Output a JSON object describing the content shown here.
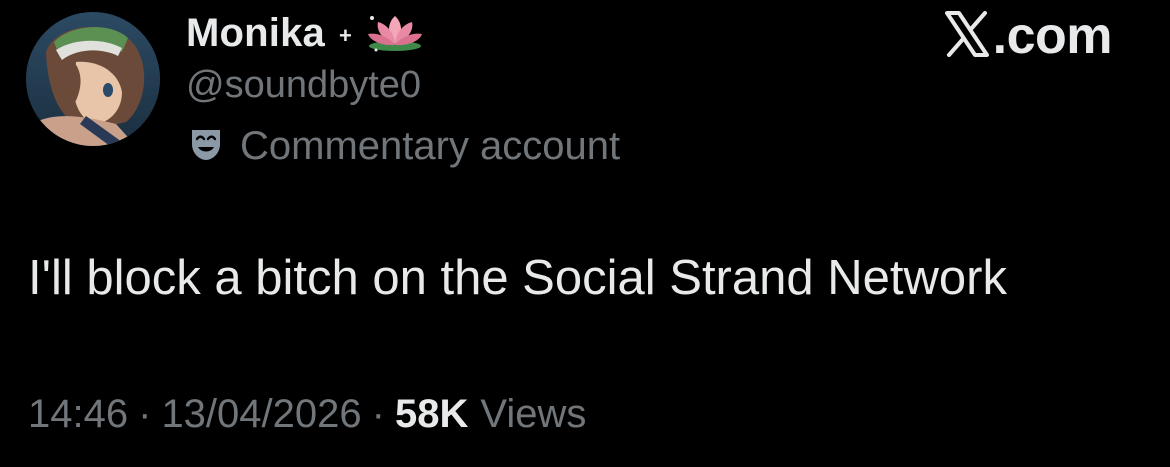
{
  "author": {
    "display_name": "Monika",
    "sparkle": "+",
    "handle": "@soundbyte0",
    "label": "Commentary account",
    "label_icon": "theater-mask-icon",
    "emoji_icon": "lotus-icon"
  },
  "brand": {
    "name": ".com",
    "logo_icon": "x-logo-icon"
  },
  "tweet": {
    "text": "I'll block a bitch on the Social Strand Network"
  },
  "meta": {
    "time": "14:46",
    "separator": "·",
    "date": "13/04/2026",
    "views_count": "58K",
    "views_label": "Views"
  },
  "colors": {
    "background": "#000000",
    "primary_text": "#e7e9ea",
    "secondary_text": "#71767b"
  }
}
